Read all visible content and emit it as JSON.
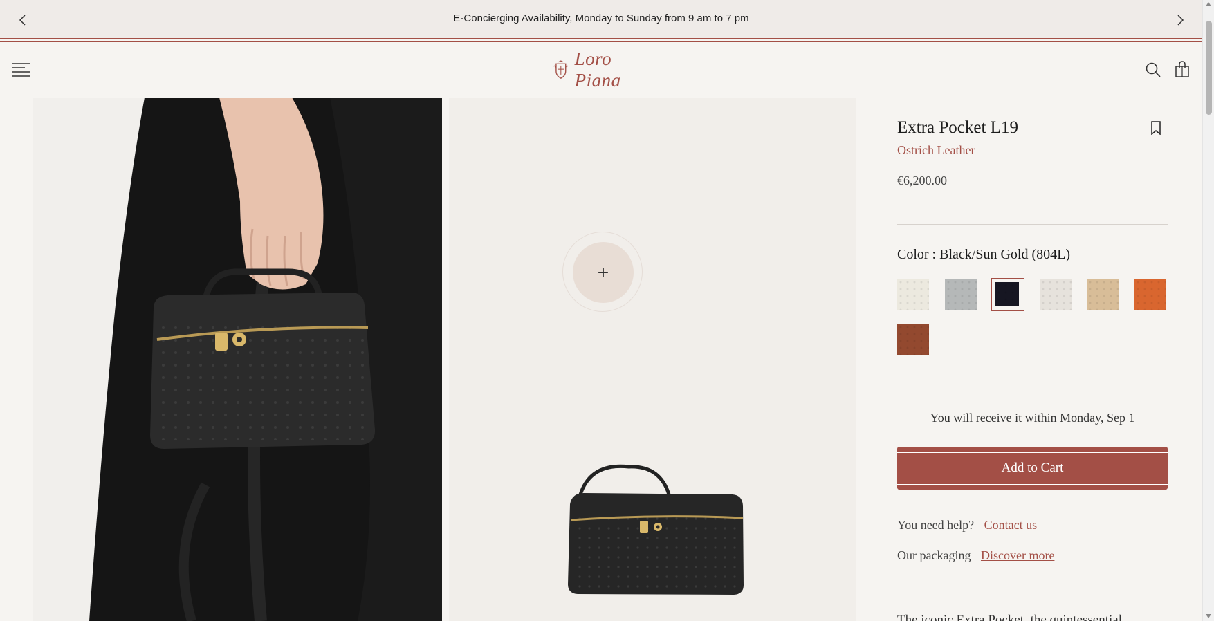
{
  "announcement": {
    "text": "E-Concierging Availability, Monday to Sunday from 9 am to 7 pm"
  },
  "header": {
    "logo_text": "Loro Piana"
  },
  "product": {
    "title": "Extra Pocket L19",
    "material": "Ostrich Leather",
    "price": "€6,200.00",
    "color_label": "Color : Black/Sun Gold (804L)",
    "swatches": [
      {
        "color": "#ece9df",
        "selected": false
      },
      {
        "color": "#b5b8b8",
        "selected": false
      },
      {
        "color": "#161622",
        "selected": true
      },
      {
        "color": "#e6e2dc",
        "selected": false
      },
      {
        "color": "#d8bd98",
        "selected": false
      },
      {
        "color": "#d9662f",
        "selected": false
      },
      {
        "color": "#93492f",
        "selected": false
      }
    ],
    "delivery": "You will receive it within Monday, Sep 1",
    "add_to_cart": "Add to Cart",
    "help_label": "You need help?",
    "help_link": "Contact us",
    "packaging_label": "Our packaging",
    "packaging_link": "Discover more",
    "description_partial": "The iconic Extra Pocket, the quintessential"
  },
  "gallery": {
    "zoom_symbol": "+"
  },
  "colors": {
    "accent": "#a34f46",
    "background": "#f6f4f1"
  }
}
